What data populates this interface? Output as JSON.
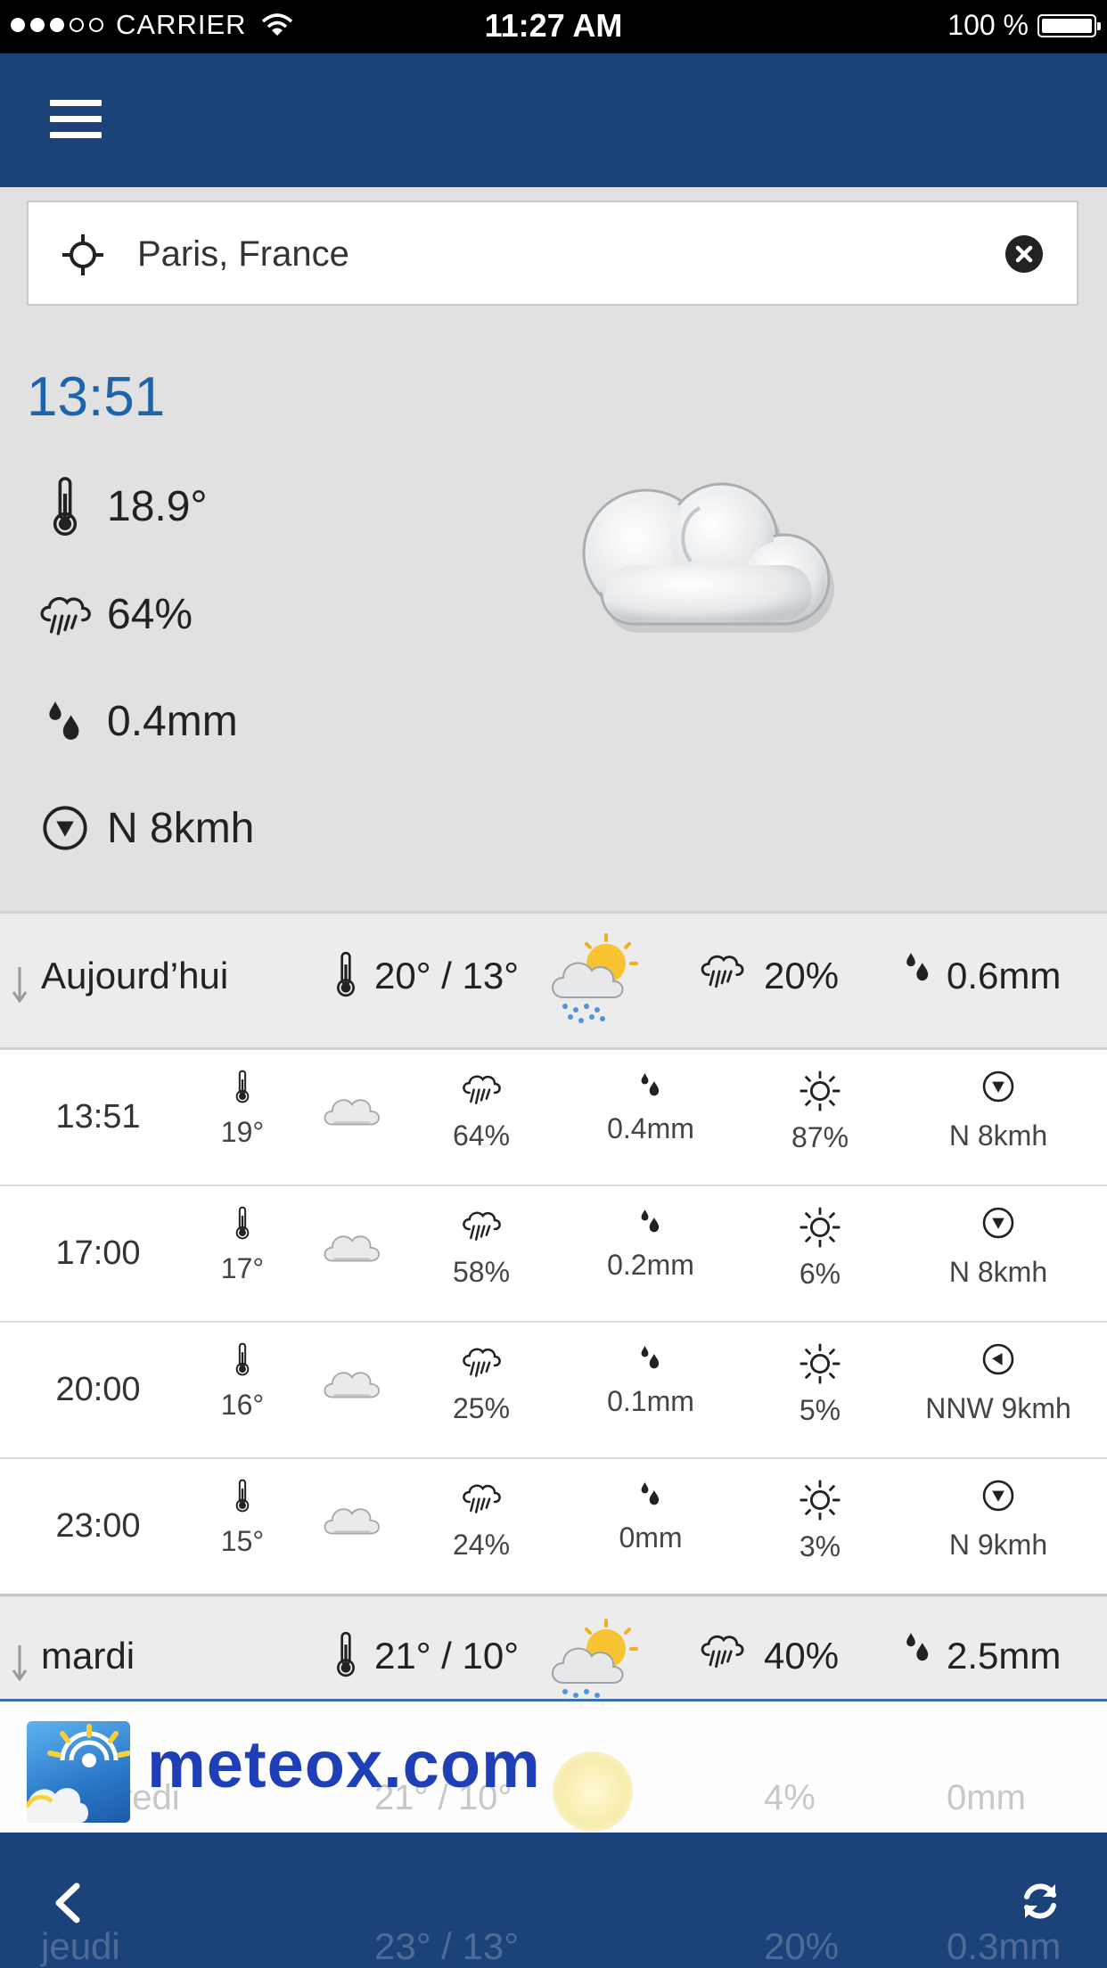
{
  "status_bar": {
    "carrier": "CARRIER",
    "time": "11:27 AM",
    "battery": "100 %"
  },
  "search": {
    "value": "Paris, France"
  },
  "current": {
    "time": "13:51",
    "temperature": "18.9°",
    "rain_chance": "64%",
    "precipitation": "0.4mm",
    "wind": "N 8kmh",
    "icon": "cloud-icon"
  },
  "days": [
    {
      "name": "Aujourd’hui",
      "temps": "20° / 13°",
      "rain": "20%",
      "precip": "0.6mm",
      "icon": "sun-cloud-rain-icon"
    },
    {
      "name": "mardi",
      "temps": "21° / 10°",
      "rain": "40%",
      "precip": "2.5mm",
      "icon": "sun-cloud-rain-icon"
    },
    {
      "name": "mercredi",
      "temps": "21° / 10°",
      "rain": "4%",
      "precip": "0mm",
      "icon": "sun-icon"
    },
    {
      "name": "jeudi",
      "temps": "23° / 13°",
      "rain": "20%",
      "precip": "0.3mm",
      "icon": "cloud-icon"
    }
  ],
  "hours": [
    {
      "time": "13:51",
      "temp": "19°",
      "rain": "64%",
      "precip": "0.4mm",
      "uv": "87%",
      "wind": "N 8kmh"
    },
    {
      "time": "17:00",
      "temp": "17°",
      "rain": "58%",
      "precip": "0.2mm",
      "uv": "6%",
      "wind": "N 8kmh"
    },
    {
      "time": "20:00",
      "temp": "16°",
      "rain": "25%",
      "precip": "0.1mm",
      "uv": "5%",
      "wind": "NNW 9kmh"
    },
    {
      "time": "23:00",
      "temp": "15°",
      "rain": "24%",
      "precip": "0mm",
      "uv": "3%",
      "wind": "N 9kmh"
    }
  ],
  "ad": {
    "brand": "meteox.com"
  },
  "colors": {
    "header": "#1b4279",
    "accent_time": "#1c64ad",
    "brand": "#1f3fb8"
  }
}
